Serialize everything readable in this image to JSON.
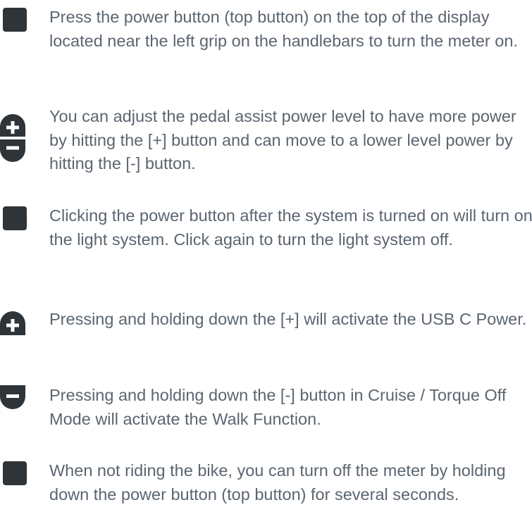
{
  "colors": {
    "text": "#5b6570",
    "icon": "#2f3438"
  },
  "instructions": [
    {
      "icon": "square-power-button-icon",
      "text": "Press the power button (top button) on the top of the display located near the left grip on the handlebars to turn the meter on."
    },
    {
      "icon": "plus-minus-buttons-icon",
      "text": "You can adjust the pedal assist power level to have more power by hitting the [+] button and can move to a lower level power by hitting the [-] button."
    },
    {
      "icon": "square-power-button-icon",
      "text": "Clicking the power button after the system is turned on will turn on the light system. Click again to turn the light system off."
    },
    {
      "icon": "plus-button-icon",
      "text": "Pressing and holding down the [+] will activate the USB C Power."
    },
    {
      "icon": "minus-button-icon",
      "text": "Pressing and holding down the [-] button in Cruise / Torque Off Mode will activate the Walk Function."
    },
    {
      "icon": "square-power-button-icon",
      "text": "When not riding the bike, you can turn off the meter by holding down the power button (top button) for several seconds."
    }
  ]
}
